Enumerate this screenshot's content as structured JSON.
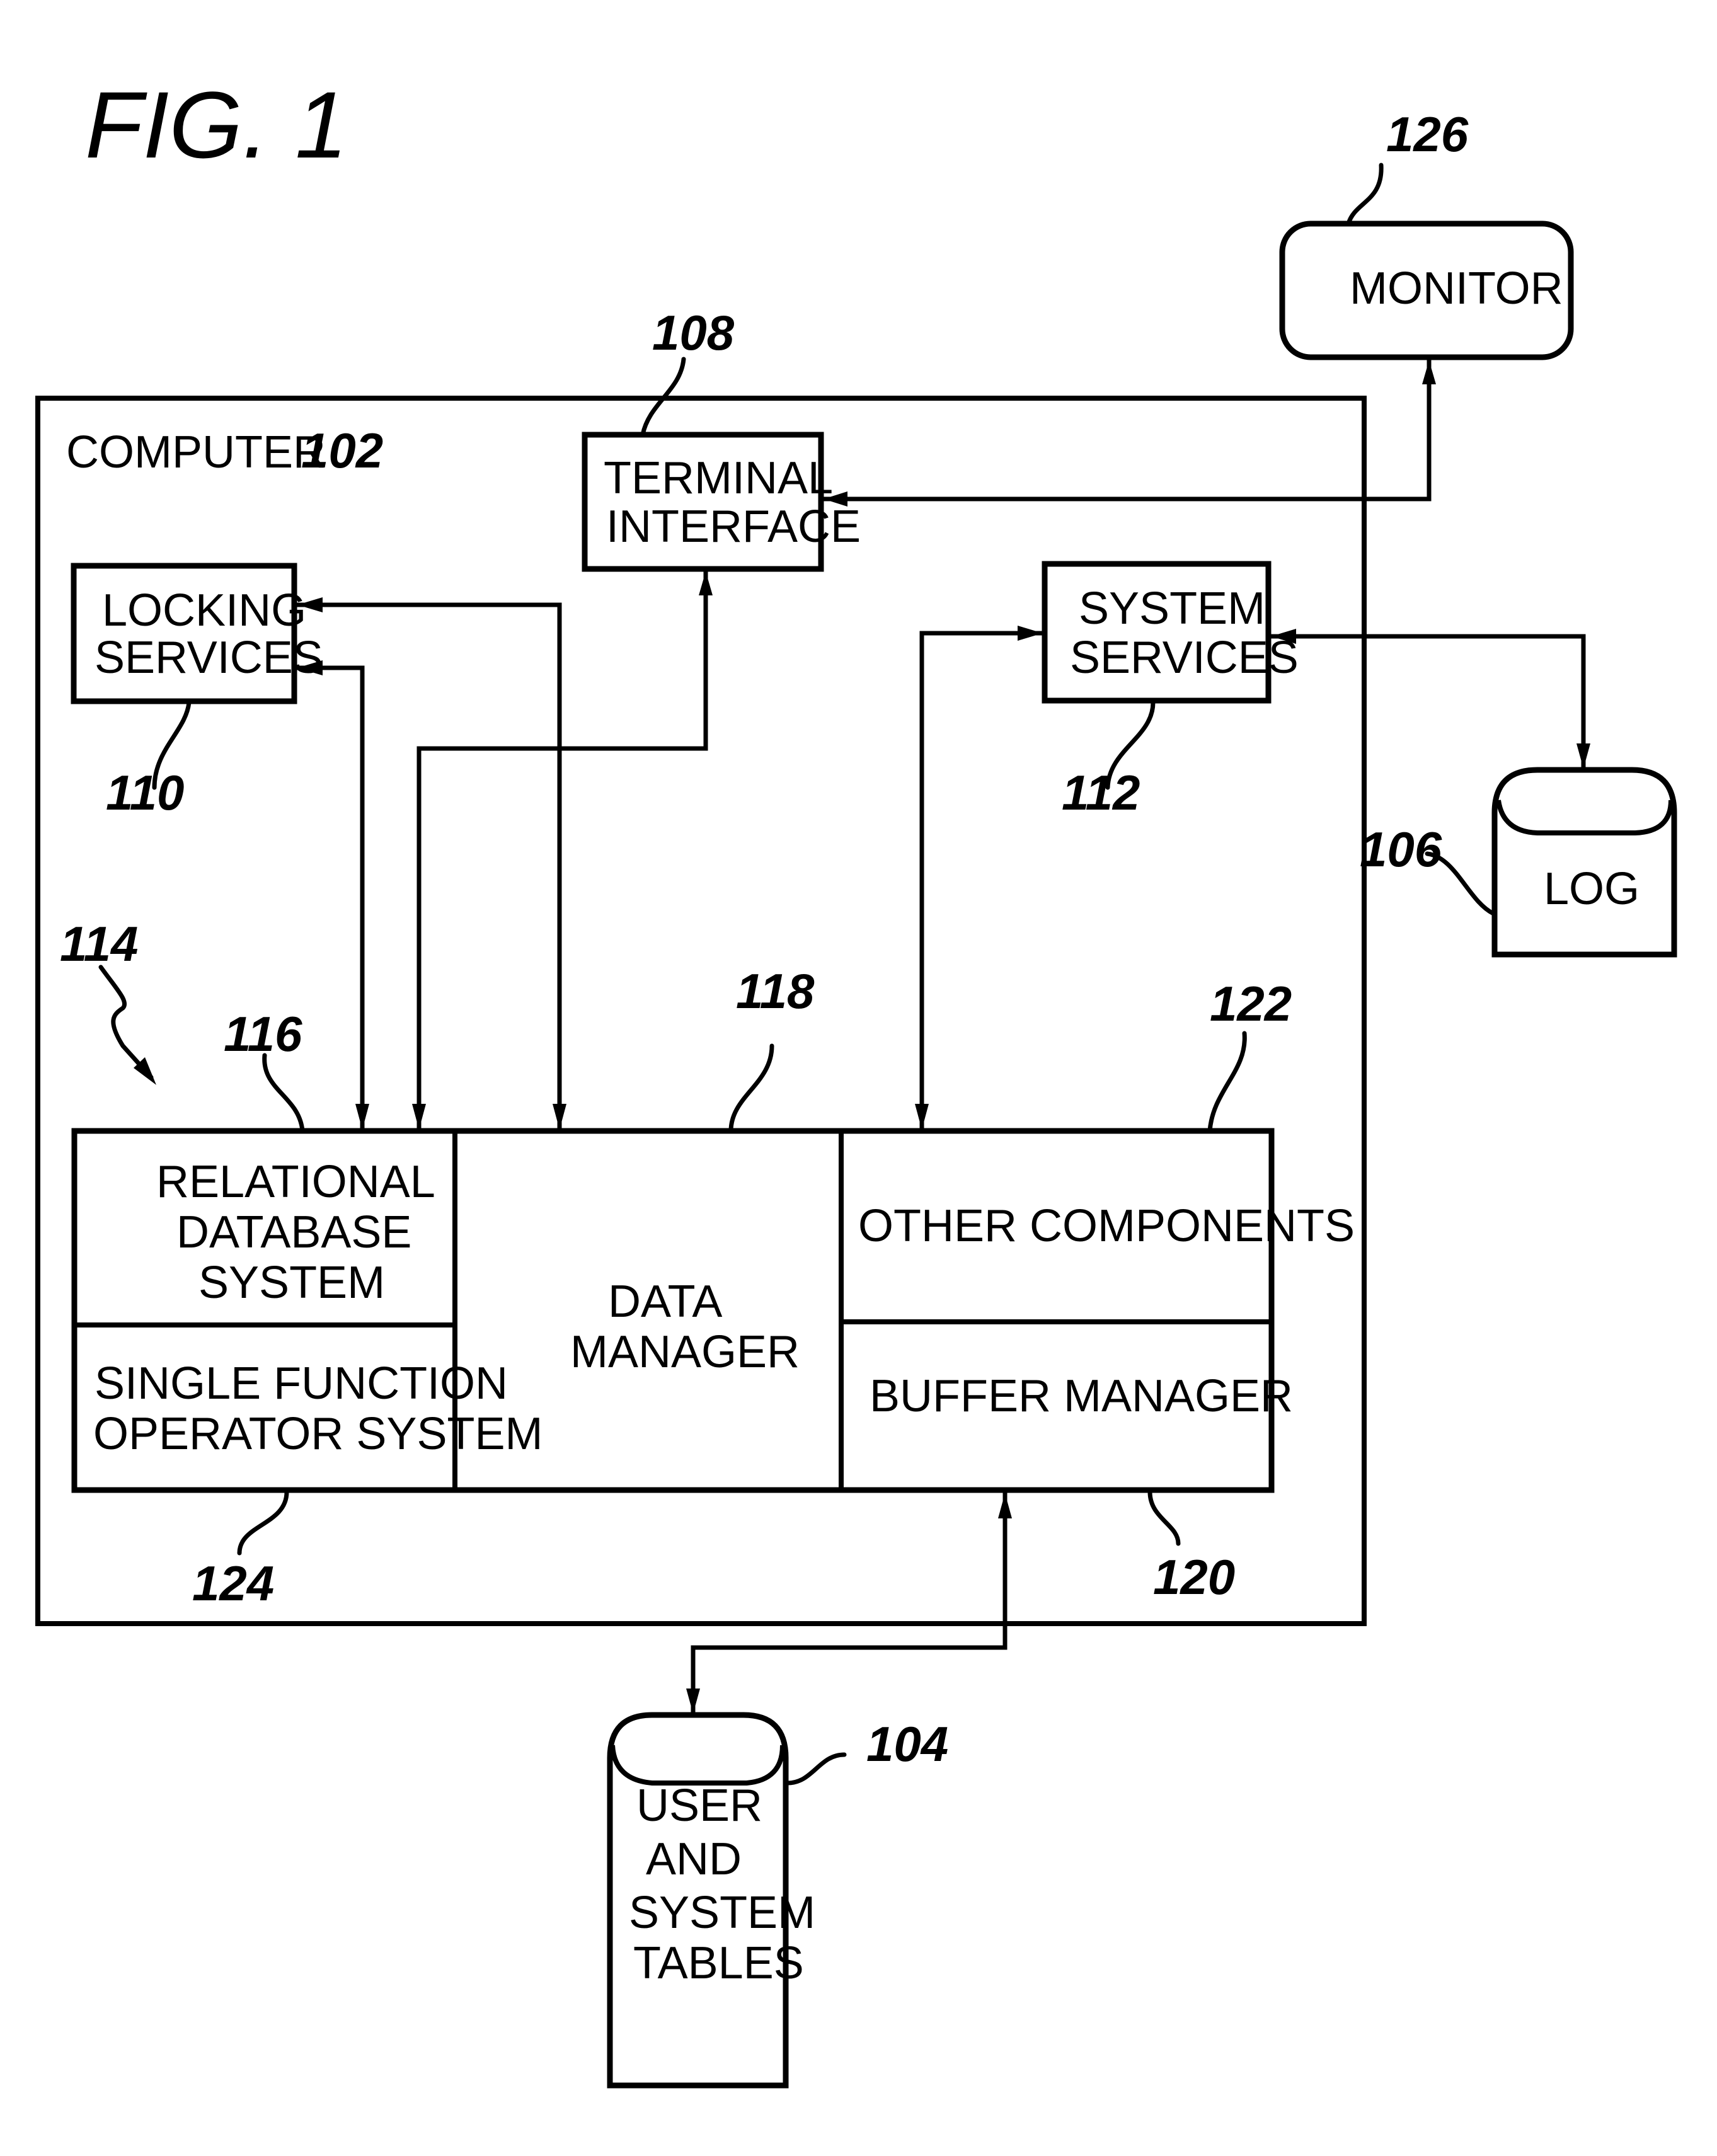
{
  "figure": {
    "title": "FIG.  1"
  },
  "computer": {
    "label": "COMPUTER",
    "ref": "102"
  },
  "components": {
    "terminal_interface": {
      "lines": [
        "TERMINAL",
        "INTERFACE"
      ],
      "ref": "108"
    },
    "locking_services": {
      "lines": [
        "LOCKING",
        "SERVICES"
      ],
      "ref": "110"
    },
    "system_services": {
      "lines": [
        "SYSTEM",
        "SERVICES"
      ],
      "ref": "112"
    },
    "monitor": {
      "lines": [
        "MONITOR"
      ],
      "ref": "126"
    },
    "log": {
      "lines": [
        "LOG"
      ],
      "ref": "106"
    },
    "user_system_tables": {
      "lines": [
        "USER",
        "AND",
        "SYSTEM",
        "TABLES"
      ],
      "ref": "104"
    },
    "relational_database_system": {
      "lines": [
        "RELATIONAL",
        "DATABASE",
        "SYSTEM"
      ],
      "ref": "116",
      "group_ref": "114"
    },
    "single_function_operator_system": {
      "lines": [
        "SINGLE  FUNCTION",
        "OPERATOR  SYSTEM"
      ],
      "ref": "124"
    },
    "data_manager": {
      "lines": [
        "DATA",
        "MANAGER"
      ],
      "ref": "118"
    },
    "other_components": {
      "lines": [
        "OTHER  COMPONENTS"
      ],
      "ref": "122"
    },
    "buffer_manager": {
      "lines": [
        "BUFFER  MANAGER"
      ],
      "ref": "120"
    }
  },
  "connections": [
    {
      "from": "monitor",
      "to": "terminal_interface",
      "direction": "both"
    },
    {
      "from": "terminal_interface",
      "to": "relational_database_system",
      "direction": "both"
    },
    {
      "from": "locking_services",
      "to": "relational_database_system",
      "direction": "both"
    },
    {
      "from": "locking_services",
      "to": "data_manager",
      "direction": "both"
    },
    {
      "from": "system_services",
      "to": "other_components",
      "direction": "both"
    },
    {
      "from": "system_services",
      "to": "log",
      "direction": "both"
    },
    {
      "from": "buffer_manager",
      "to": "user_system_tables",
      "direction": "both"
    }
  ]
}
